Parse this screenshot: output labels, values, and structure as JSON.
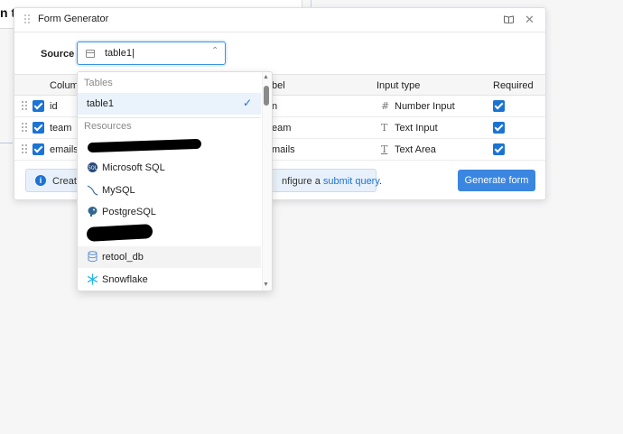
{
  "background": {
    "title": "n ti"
  },
  "modal": {
    "title": "Form Generator",
    "source": {
      "label": "Source",
      "value": "table1|"
    },
    "table": {
      "headers": [
        "Colum",
        "bel",
        "Input type",
        "Required"
      ],
      "rows": [
        {
          "column": "id",
          "label": "n",
          "input_type": "Number Input",
          "type_icon": "#"
        },
        {
          "column": "team",
          "label": "eam",
          "input_type": "Text Input",
          "type_icon": "T"
        },
        {
          "column": "emails",
          "label": "mails",
          "input_type": "Text Area",
          "type_icon": "T"
        }
      ]
    },
    "info": {
      "prefix": "Creati",
      "middle": "nfigure a ",
      "link": "submit query",
      "suffix": "."
    },
    "generate_button": "Generate form"
  },
  "dropdown": {
    "tables_heading": "Tables",
    "tables": [
      {
        "label": "table1",
        "selected": true
      }
    ],
    "resources_heading": "Resources",
    "resources": [
      {
        "label": "",
        "redacted": true
      },
      {
        "label": "Microsoft SQL",
        "icon": "mssql-icon"
      },
      {
        "label": "MySQL",
        "icon": "mysql-icon"
      },
      {
        "label": "PostgreSQL",
        "icon": "postgresql-icon"
      },
      {
        "label": "",
        "redacted": true
      },
      {
        "label": "retool_db",
        "icon": "database-icon"
      },
      {
        "label": "Snowflake",
        "icon": "snowflake-icon"
      }
    ]
  },
  "colors": {
    "accent": "#1b73d3",
    "button": "#3b86e0",
    "banner": "#e8f1fb"
  }
}
